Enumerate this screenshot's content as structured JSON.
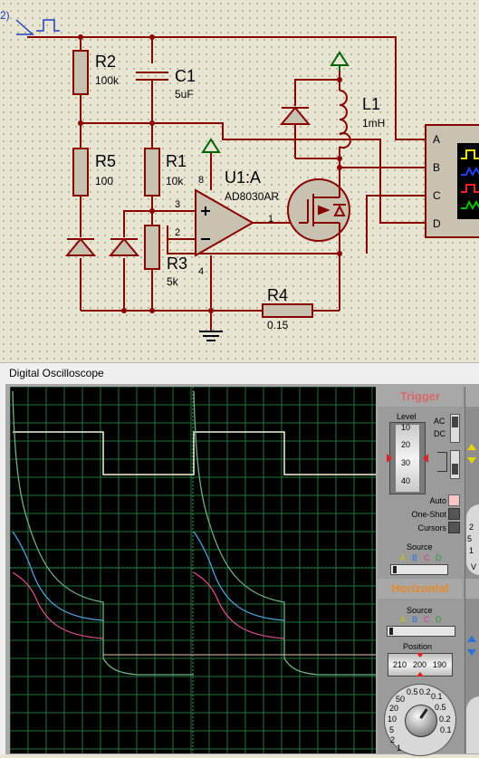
{
  "schematic": {
    "generator_ref": "2)",
    "components": {
      "r2": {
        "name": "R2",
        "value": "100k"
      },
      "c1": {
        "name": "C1",
        "value": "5uF"
      },
      "r5": {
        "name": "R5",
        "value": "100"
      },
      "r1": {
        "name": "R1",
        "value": "10k"
      },
      "u1": {
        "name": "U1:A",
        "value": "AD8030AR"
      },
      "l1": {
        "name": "L1",
        "value": "1mH"
      },
      "r3": {
        "name": "R3",
        "value": "5k"
      },
      "r4": {
        "name": "R4",
        "value": "0.15"
      }
    },
    "pins": {
      "p8": "8",
      "p3": "3",
      "p2": "2",
      "p4": "4",
      "p1": "1"
    },
    "scope_channels": [
      "A",
      "B",
      "C",
      "D"
    ]
  },
  "oscilloscope": {
    "title": "Digital Oscilloscope",
    "trigger": {
      "heading": "Trigger",
      "level_label": "Level",
      "level_scale": [
        "10",
        "20",
        "30",
        "40"
      ],
      "ac": "AC",
      "dc": "DC",
      "auto": "Auto",
      "one_shot": "One-Shot",
      "cursors": "Cursors",
      "source_label": "Source",
      "source_channels": [
        "A",
        "B",
        "C",
        "D"
      ]
    },
    "horizontal": {
      "heading": "Horizontal",
      "source_label": "Source",
      "source_channels": [
        "A",
        "B",
        "C",
        "D"
      ],
      "position_label": "Position",
      "position_values": [
        "210",
        "200",
        "190"
      ],
      "dial_labels": [
        "0.5",
        "0.2",
        "0.1",
        "50",
        "20",
        "10",
        "5",
        "2",
        "1",
        "0.5",
        "0.2",
        "0.1"
      ]
    },
    "right_partial": {
      "left_dial_labels": [
        "2",
        "5",
        "1"
      ],
      "v_label": "V"
    },
    "colors": {
      "trace_a": "#f2f2d8",
      "trace_b": "#6fae7e",
      "trace_c": "#4f9fd8",
      "trace_d": "#d64b8a",
      "grid": "#1f6f3a",
      "trigger_head": "#d9686a",
      "horizontal_head": "#e88a2a",
      "wire": "#8b0000",
      "component": "#8b0000",
      "fill": "#c8c2b0",
      "power": "#006400"
    }
  }
}
